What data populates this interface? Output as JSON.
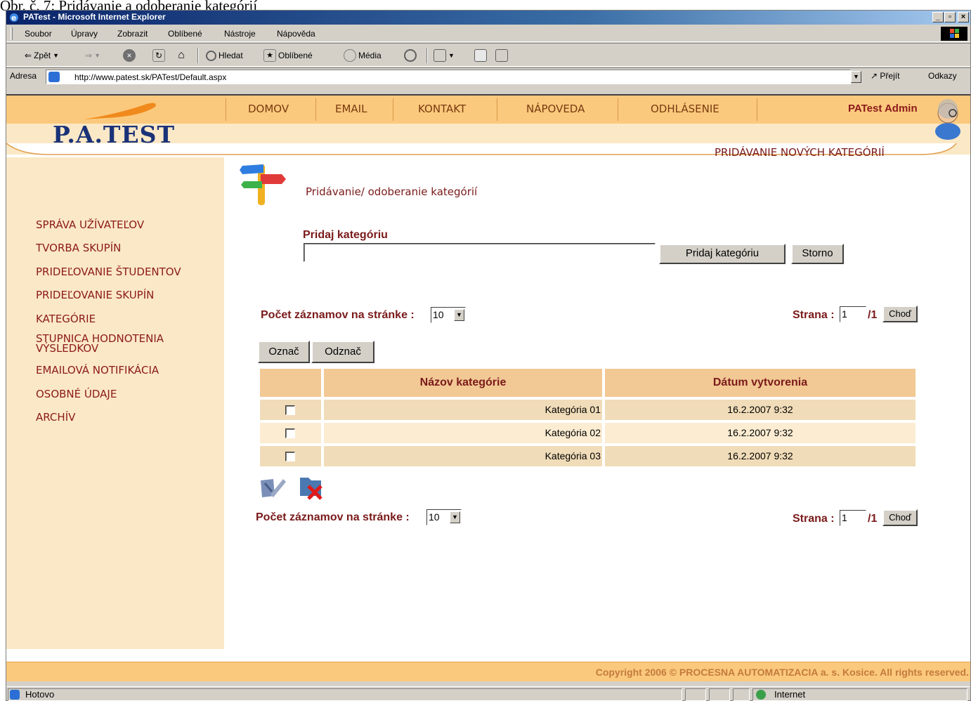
{
  "caption": "Obr. č. 7: Pridávanie a odoberanie kategórií",
  "window": {
    "title": "PATest - Microsoft Internet Explorer"
  },
  "menu": [
    "Soubor",
    "Úpravy",
    "Zobrazit",
    "Oblíbené",
    "Nástroje",
    "Nápověda"
  ],
  "toolbar": {
    "back": "Zpět",
    "search": "Hledat",
    "favorites": "Oblíbené",
    "media": "Média"
  },
  "address": {
    "label": "Adresa",
    "url": "http://www.patest.sk/PATest/Default.aspx",
    "go": "Přejít",
    "links": "Odkazy"
  },
  "site": {
    "logo": "P.A.TEST",
    "nav": [
      "DOMOV",
      "EMAIL",
      "KONTAKT",
      "NÁPOVEDA",
      "ODHLÁSENIE"
    ],
    "user": "PATest Admin",
    "section_title": "PRIDÁVANIE NOVÝCH KATEGÓRIÍ"
  },
  "sidebar": [
    "SPRÁVA UŽÍVATEĽOV",
    "TVORBA SKUPÍN",
    "PRIDEĽOVANIE ŠTUDENTOV",
    "PRIDEĽOVANIE SKUPÍN",
    "KATEGÓRIE",
    "STUPNICA HODNOTENIA\nVÝSLEDKOV",
    "EMAILOVÁ NOTIFIKÁCIA",
    "OSOBNÉ ÚDAJE",
    "ARCHÍV"
  ],
  "main": {
    "heading": "Pridávanie/ odoberanie kategórií",
    "field_label": "Pridaj kategóriu",
    "input_value": "",
    "add_button": "Pridaj kategóriu",
    "cancel_button": "Storno",
    "records_label": "Počet záznamov na stránke :",
    "records_value": "10",
    "page_label": "Strana :",
    "page_value": "1",
    "page_total": "/1",
    "go_button": "Choď",
    "mark_button": "Označ",
    "unmark_button": "Odznač",
    "table": {
      "headers": [
        "Názov kategórie",
        "Dátum vytvorenia"
      ],
      "rows": [
        {
          "name": "Kategória 01",
          "date": "16.2.2007 9:32",
          "checked": false
        },
        {
          "name": "Kategória 02",
          "date": "16.2.2007 9:32",
          "checked": false
        },
        {
          "name": "Kategória 03",
          "date": "16.2.2007 9:32",
          "checked": false
        }
      ]
    }
  },
  "footer": "Copyright 2006 © PROCESNA AUTOMATIZACIA a. s. Kosice. All rights reserved.",
  "status": {
    "left": "Hotovo",
    "zone": "Internet"
  }
}
